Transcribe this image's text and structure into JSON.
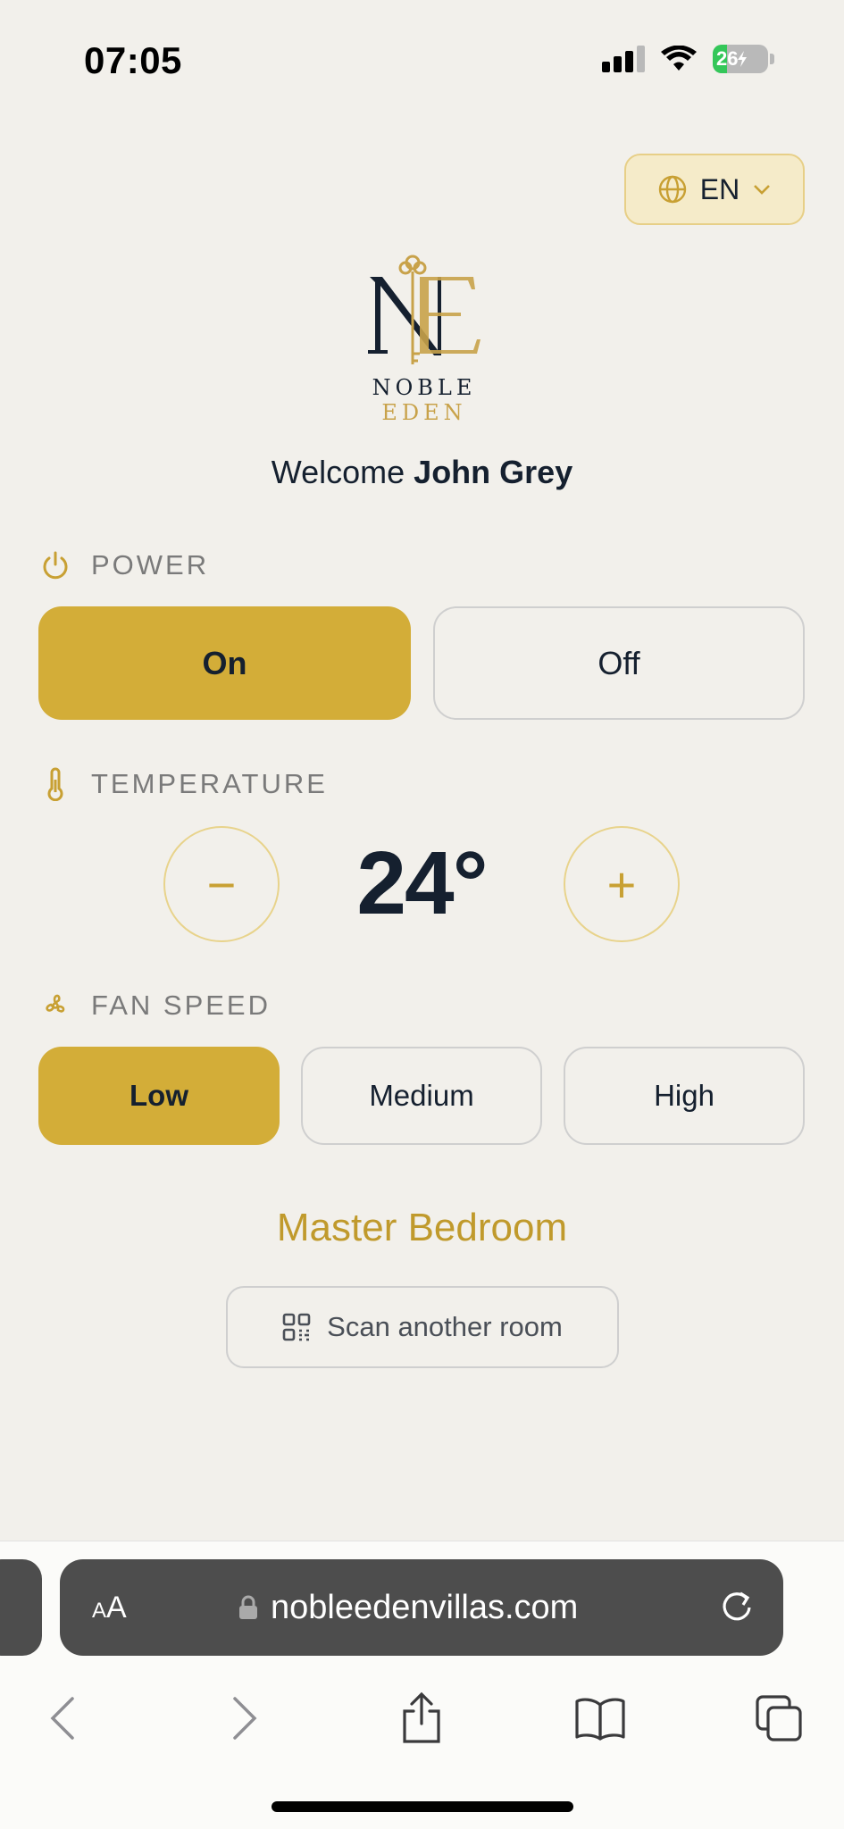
{
  "status_bar": {
    "time": "07:05",
    "battery": "26",
    "battery_level": 0.26
  },
  "language": {
    "label": "EN"
  },
  "logo": {
    "word_primary": "NOBLE",
    "word_accent": "EDEN"
  },
  "welcome": {
    "prefix": "Welcome",
    "name": "John Grey"
  },
  "power": {
    "label": "POWER",
    "on_label": "On",
    "off_label": "Off",
    "selected": "On"
  },
  "temperature": {
    "label": "TEMPERATURE",
    "value": "24°",
    "decrease_symbol": "−",
    "increase_symbol": "+"
  },
  "fan_speed": {
    "label": "FAN SPEED",
    "options": [
      "Low",
      "Medium",
      "High"
    ],
    "selected": "Low"
  },
  "room": {
    "name": "Master Bedroom",
    "scan_label": "Scan another room"
  },
  "browser": {
    "aa_small": "A",
    "aa_large": "A",
    "url": "nobleedenvillas.com"
  },
  "colors": {
    "accent": "#d3ad38",
    "accent_text": "#c09a2c",
    "background": "#f2f0eb",
    "text_dark": "#15202f"
  },
  "icons": {
    "power": "power-icon",
    "temperature": "thermometer-icon",
    "fan": "fan-icon",
    "language": "globe-icon",
    "scan": "qr-code-icon"
  }
}
